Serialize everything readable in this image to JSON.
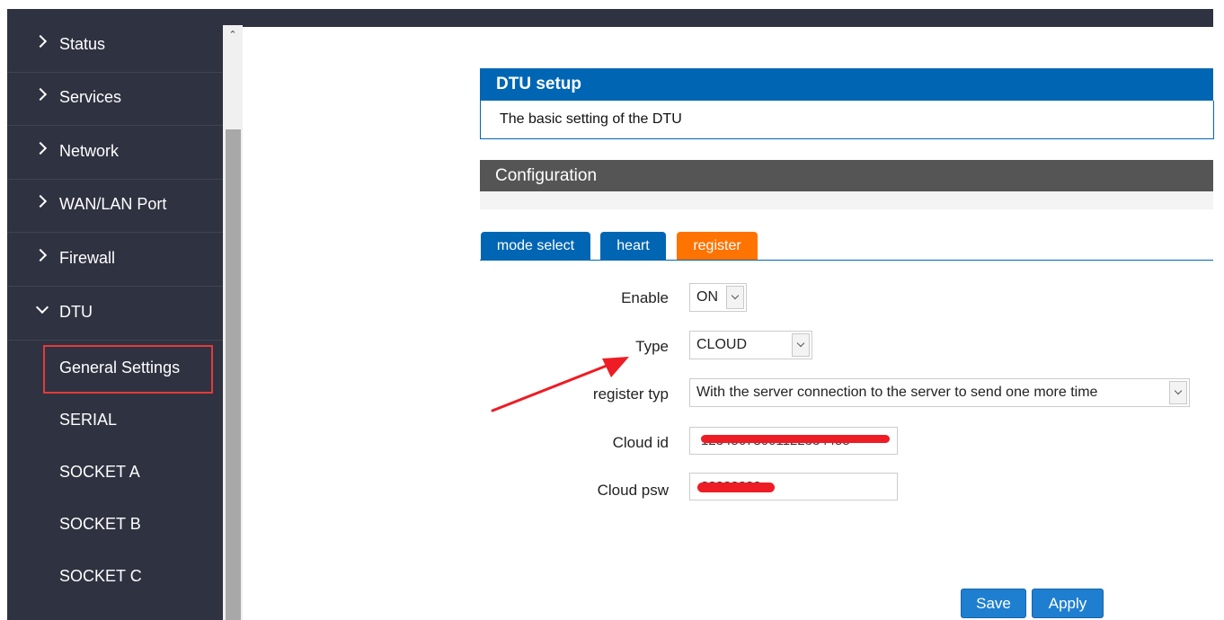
{
  "sidebar": {
    "items": [
      {
        "label": "Status"
      },
      {
        "label": "Services"
      },
      {
        "label": "Network"
      },
      {
        "label": "WAN/LAN Port"
      },
      {
        "label": "Firewall"
      },
      {
        "label": "DTU"
      }
    ],
    "dtu_subitems": [
      {
        "label": "General Settings",
        "highlighted": true
      },
      {
        "label": "SERIAL"
      },
      {
        "label": "SOCKET A"
      },
      {
        "label": "SOCKET B"
      },
      {
        "label": "SOCKET C"
      }
    ]
  },
  "main": {
    "panel_title": "DTU setup",
    "panel_desc": "The basic setting of the DTU",
    "config_title": "Configuration",
    "tabs": [
      {
        "label": "mode select",
        "active": false
      },
      {
        "label": "heart",
        "active": false
      },
      {
        "label": "register",
        "active": true
      }
    ],
    "form": {
      "enable": {
        "label": "Enable",
        "value": "ON"
      },
      "type": {
        "label": "Type",
        "value": "CLOUD"
      },
      "register_typ": {
        "label": "register typ",
        "value": "With the server connection to the server to send one more time"
      },
      "cloud_id": {
        "label": "Cloud id",
        "value": "12345678001122334455"
      },
      "cloud_psw": {
        "label": "Cloud psw",
        "value": "88888888"
      }
    },
    "buttons": {
      "save": "Save",
      "apply": "Apply"
    }
  },
  "colors": {
    "sidebar_bg": "#2f3240",
    "accent_blue": "#0066b3",
    "active_tab": "#ff7300",
    "highlight_red": "#e23b3b",
    "annotation_red": "#ee1c24"
  },
  "icons": {
    "nav_collapsed": "chevron-right-icon",
    "nav_expanded": "chevron-down-icon",
    "scroll_up": "caret-up-icon",
    "select": "chevron-down-icon"
  }
}
